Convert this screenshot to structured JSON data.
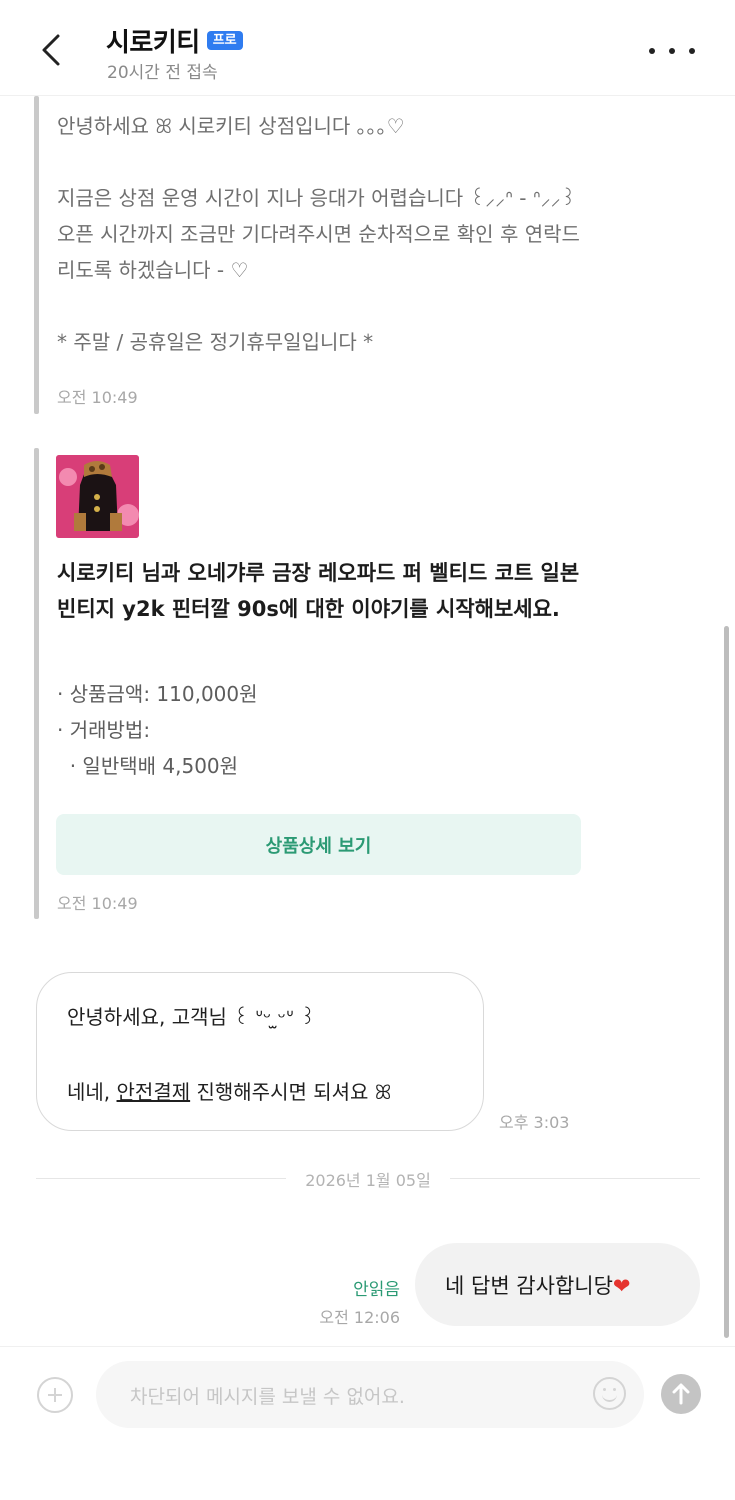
{
  "header": {
    "title": "시로키티",
    "badge": "프로",
    "subtitle": "20시간 전 접속"
  },
  "messages": {
    "auto_reply": {
      "text": "안녕하세요 ꕤ 시로키티 상점입니다 ｡｡｡♡\n\n지금은 상점 운영 시간이 지나 응대가 어렵습니다 ꒰⸝⸝ᐢ - ᐢ⸝⸝꒱ 오픈 시간까지 조금만 기다려주시면 순차적으로 확인 후 연락드리도록 하겠습니다 - ♡\n\n* 주말 / 공휴일은 정기휴무일입니다 *",
      "time": "오전 10:49"
    },
    "product_card": {
      "title": "시로키티 님과 오네갸루 금장 레오파드 퍼 벨티드 코트 일본빈티지 y2k 핀터깔 90s에 대한 이야기를 시작해보세요.",
      "line1": "· 상품금액: 110,000원",
      "line2": "· 거래방법:",
      "line3": "  · 일반택배 4,500원",
      "button": "상품상세 보기",
      "time": "오전 10:49"
    },
    "reply": {
      "line1": "안녕하세요, 고객님 ꒰ ᐡᵕ ̫ᵕᐡ ꒱",
      "line2_pre": "네네, ",
      "line2_link": "안전결제",
      "line2_post": " 진행해주시면 되셔요 ꕤ",
      "time": "오후 3:03"
    },
    "date_divider": "2026년 1월 05일",
    "outgoing": {
      "text": "네 답변 감사합니당",
      "emoji": "❤",
      "status": "안읽음",
      "time": "오전 12:06"
    }
  },
  "composer": {
    "placeholder": "차단되어 메시지를 보낼 수 없어요."
  },
  "colors": {
    "accent": "#2b9a74",
    "badge": "#2f7cf0",
    "heart": "#e5342f"
  }
}
